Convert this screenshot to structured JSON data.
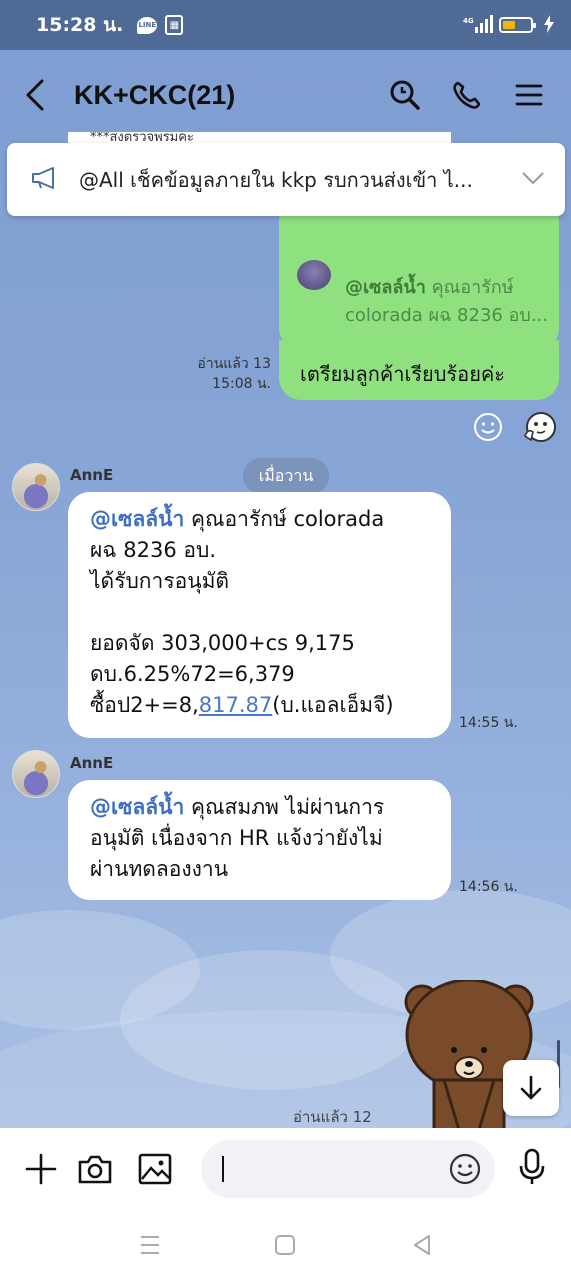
{
  "status_bar": {
    "time": "15:28 น.",
    "line_icon": "LINE",
    "network": "4G",
    "colors": {
      "bar": "#4e6a95",
      "battery": "#f5b400"
    }
  },
  "header": {
    "title": "KK+CKC(21)",
    "icons": [
      "back-icon",
      "search-icon",
      "phone-icon",
      "menu-icon"
    ]
  },
  "announcement": {
    "peek_text": "***สงตรวจพรมคะ",
    "text": "@All  เช็คข้อมูลภายใน kkp รบกวนส่งเข้า ไ..."
  },
  "my_message": {
    "quote_mention": "@เซลล์น้ำ",
    "quote_rest": " คุณอารักษ์",
    "quote_line2": "colorada ผฉ 8236 อบ...",
    "text": "เตรียมลูกค้าเรียบร้อยค่ะ",
    "read_status": "อ่านแล้ว 13",
    "time": "15:08 น.",
    "color": "#8fe07f"
  },
  "date_divider": "เมื่อวาน",
  "messages": [
    {
      "sender": "AnnE",
      "mention": "@เซลล์น้ำ",
      "line1_rest": " คุณอารักษ์ colorada",
      "line2": "ผฉ 8236 อบ.",
      "line3": "ได้รับการอนุมัติ",
      "line4": "ยอดจัด 303,000+cs 9,175",
      "line5": "ดบ.6.25%72=6,379",
      "line6_pre": "ซื้อป2+=8,",
      "line6_link": "817.87",
      "line6_post": "(บ.แอลเอ็มจี)",
      "time": "14:55 น."
    },
    {
      "sender": "AnnE",
      "mention": "@เซลล์น้ำ",
      "line1_rest": " คุณสมภพ ไม่ผ่านการ",
      "line2": "อนุมัติ เนื่องจาก HR แจ้งว่ายังไม่",
      "line3": "ผ่านทดลองงาน",
      "time": "14:56 น."
    }
  ],
  "bottom_read": "อ่านแล้ว 12",
  "input": {
    "placeholder": "",
    "value": ""
  },
  "accent": "#3d6ec2",
  "chat_bg": "#87a5d6"
}
